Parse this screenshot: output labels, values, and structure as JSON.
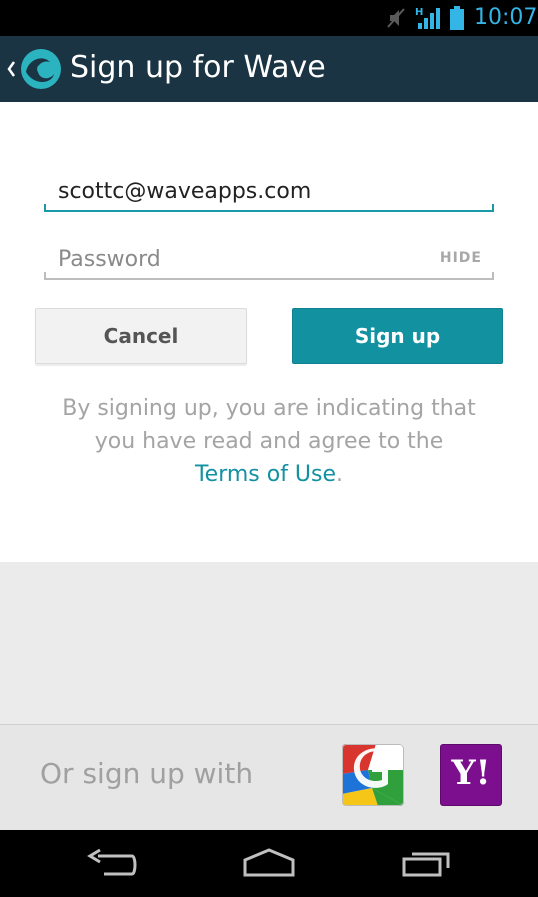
{
  "status_bar": {
    "network_type": "H",
    "time": "10:07",
    "icons": [
      "mute-icon",
      "signal-icon",
      "battery-icon"
    ]
  },
  "action_bar": {
    "title": "Sign up for Wave",
    "icons": [
      "back-chevron-icon",
      "wave-logo-icon"
    ]
  },
  "form": {
    "email": {
      "value": "scottc@waveapps.com",
      "placeholder": ""
    },
    "password": {
      "value": "",
      "placeholder": "Password",
      "toggle_label": "HIDE"
    },
    "cancel_label": "Cancel",
    "signup_label": "Sign up",
    "terms_line1": "By signing up, you are indicating that",
    "terms_line2": "you have read and agree to the",
    "terms_link": "Terms of Use",
    "terms_end": "."
  },
  "social": {
    "label": "Or sign up with",
    "providers": [
      {
        "name": "google",
        "icon": "google-icon"
      },
      {
        "name": "yahoo",
        "icon": "yahoo-icon",
        "text": "Y!"
      }
    ]
  },
  "nav_bar": {
    "icons": [
      "back-icon",
      "home-icon",
      "recent-apps-icon"
    ]
  },
  "colors": {
    "action_bar": "#1a3443",
    "accent": "#1291a1",
    "status_icons": "#33b5e5",
    "yahoo_purple": "#7b0f8e"
  }
}
